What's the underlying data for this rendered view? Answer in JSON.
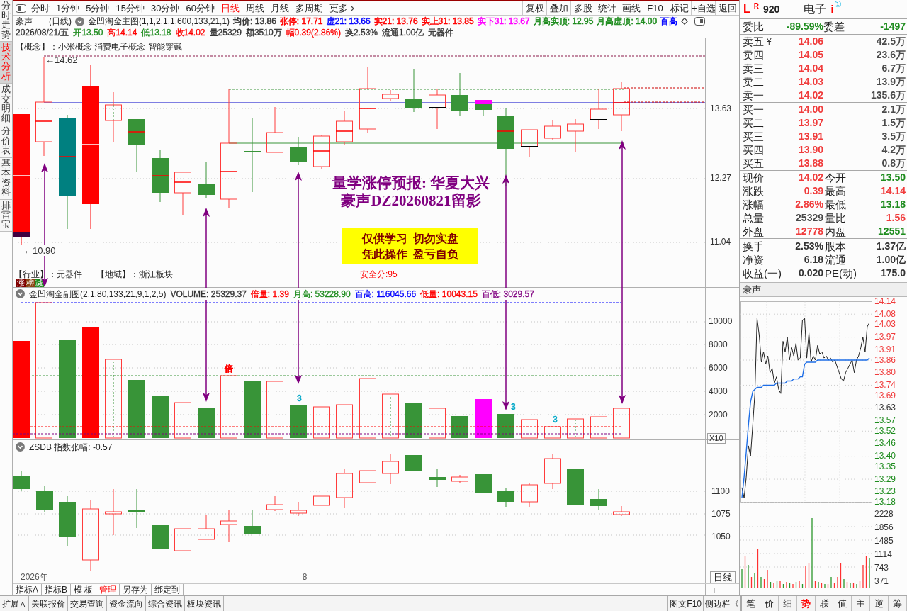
{
  "side_tabs": [
    {
      "label": "分时走势",
      "selected": false
    },
    {
      "label": "技术分析",
      "selected": true
    },
    {
      "label": "成交明细",
      "selected": false
    },
    {
      "label": "分价表",
      "selected": false
    },
    {
      "label": "基本资料",
      "selected": false
    },
    {
      "label": "排雷宝",
      "selected": false
    }
  ],
  "toolbar": {
    "periods": [
      {
        "label": "分时",
        "selected": false
      },
      {
        "label": "1分钟",
        "selected": false
      },
      {
        "label": "5分钟",
        "selected": false
      },
      {
        "label": "15分钟",
        "selected": false
      },
      {
        "label": "30分钟",
        "selected": false
      },
      {
        "label": "60分钟",
        "selected": false
      },
      {
        "label": "日线",
        "selected": true
      },
      {
        "label": "周线",
        "selected": false
      },
      {
        "label": "月线",
        "selected": false
      },
      {
        "label": "多周期",
        "selected": false
      },
      {
        "label": "更多",
        "selected": false
      }
    ],
    "buttons": [
      "复权",
      "叠加",
      "多股",
      "统计",
      "画线",
      "F10",
      "标记",
      "+自选",
      "返回"
    ]
  },
  "header": {
    "stock": "豪声",
    "period": "(日线)",
    "indicator": "金凹淘金主图(1,1,2,1,1,600,133,21,1)",
    "values": [
      {
        "text": "均价: 13.86",
        "color": "#333333"
      },
      {
        "text": "张停: 17.71",
        "color": "#ff0000"
      },
      {
        "text": "虚21: 13.66",
        "color": "#0000ff"
      },
      {
        "text": "实21: 13.76",
        "color": "#ff0000"
      },
      {
        "text": "实上31: 13.85",
        "color": "#ff0000"
      },
      {
        "text": "实下31: 13.67",
        "color": "#ff00ff"
      },
      {
        "text": "月高实顶: 12.95",
        "color": "#1e8c1e"
      },
      {
        "text": "月高虚顶: 14.00",
        "color": "#1e8c1e"
      },
      {
        "text": "百高",
        "color": "#0000ff"
      }
    ],
    "quote": [
      {
        "text": "2026/08/21/五",
        "color": "#333333"
      },
      {
        "text": "开13.50",
        "color": "#1e8c1e"
      },
      {
        "text": "高14.14",
        "color": "#ff0000"
      },
      {
        "text": "低13.18",
        "color": "#1e8c1e"
      },
      {
        "text": "收14.02",
        "color": "#ff0000"
      },
      {
        "text": "量25329",
        "color": "#333333"
      },
      {
        "text": "额3510万",
        "color": "#333333"
      },
      {
        "text": "幅0.39(2.86%)",
        "color": "#ff0000"
      },
      {
        "text": "换2.53%",
        "color": "#333333"
      },
      {
        "text": "流通1.00亿",
        "color": "#333333"
      },
      {
        "text": "元器件",
        "color": "#333333"
      }
    ]
  },
  "main_chart": {
    "concepts": "【概念】：小米概念 消费电子概念 智能穿戴",
    "high_marker": "←14.62",
    "low_marker": "←10.90",
    "y_labels": [
      "13.63",
      "12.27",
      "11.04"
    ],
    "forecast_lines": [
      "量学涨停预报: 华夏大兴",
      "豪声DZ20260821留影"
    ],
    "disclaimer_lines": [
      "仅供学习  切勿实盘",
      "凭此操作  盈亏自负"
    ],
    "industry": "【行业】：元器件",
    "region": "【地域】：浙江板块",
    "safety_score": "安全分:95",
    "rank_tags": [
      {
        "label": "涨",
        "color": "#800000"
      },
      {
        "label": "榜",
        "color": "#8b4513"
      },
      {
        "label": "减",
        "color": "#1e8c1e"
      }
    ]
  },
  "volume_panel": {
    "title": "金凹淘金副图(2,1.80,133,21,9,1,2,5)",
    "values": [
      {
        "text": "VOLUME: 25329.37",
        "color": "#333333"
      },
      {
        "text": "倍量: 1.39",
        "color": "#ff0000"
      },
      {
        "text": "月高: 53228.90",
        "color": "#1e8c1e"
      },
      {
        "text": "百高: 116045.66",
        "color": "#0000ff"
      },
      {
        "text": "低量: 10043.15",
        "color": "#ff0000"
      },
      {
        "text": "百低: 3029.57",
        "color": "#800080"
      }
    ],
    "y_labels": [
      "10000",
      "8000",
      "6000",
      "4000",
      "2000"
    ],
    "scale_label": "X10",
    "bar_marks": [
      {
        "text": "倍",
        "color": "#ff0000"
      },
      {
        "text": "3",
        "color": "#00a8c8"
      },
      {
        "text": "3",
        "color": "#00a8c8"
      },
      {
        "text": "3",
        "color": "#00a8c8"
      }
    ]
  },
  "index_panel": {
    "title": "ZSDB 指数张幅: -0.57",
    "y_labels": [
      "1100",
      "1075",
      "1050"
    ]
  },
  "time_axis": {
    "labels": [
      "2026年",
      "8"
    ],
    "period": "日线",
    "zoom_buttons": [
      "+",
      "−"
    ]
  },
  "bottom_tabs": [
    {
      "label": "指标A",
      "selected": false
    },
    {
      "label": "指标B",
      "selected": false
    },
    {
      "label": "模 板",
      "selected": false
    },
    {
      "label": "管理",
      "selected": true
    },
    {
      "label": "另存为",
      "selected": false
    },
    {
      "label": "绑定到",
      "selected": false
    }
  ],
  "status_bar": {
    "links": [
      "扩展∧",
      "关联报价",
      "交易查询",
      "资金流向",
      "综合资讯",
      "板块资讯"
    ],
    "side_buttons": [
      "图文F10",
      "侧边栏《"
    ],
    "shortcuts": [
      {
        "label": "笔",
        "selected": false
      },
      {
        "label": "价",
        "selected": false
      },
      {
        "label": "细",
        "selected": false
      },
      {
        "label": "势",
        "selected": true
      },
      {
        "label": "联",
        "selected": false
      },
      {
        "label": "值",
        "selected": false
      },
      {
        "label": "主",
        "selected": false
      },
      {
        "label": "逆",
        "selected": false
      },
      {
        "label": "筹",
        "selected": false
      }
    ]
  },
  "quote_panel": {
    "market": "L",
    "board": "R",
    "code": "920",
    "name": "电子",
    "info_mark": "i",
    "badge": "①",
    "ratio": [
      {
        "label": "委比",
        "value": "-89.59%",
        "color": "#1e8c1e"
      },
      {
        "label": "委差",
        "value": "-1497",
        "color": "#1e8c1e"
      }
    ],
    "asks": [
      {
        "label": "卖五",
        "mark": "¥",
        "price": "14.06",
        "volume": "42.5万"
      },
      {
        "label": "卖四",
        "price": "14.05",
        "volume": "23.6万"
      },
      {
        "label": "卖三",
        "price": "14.04",
        "volume": "6.7万"
      },
      {
        "label": "卖二",
        "price": "14.03",
        "volume": "13.9万"
      },
      {
        "label": "卖一",
        "price": "14.02",
        "volume": "135.6万"
      }
    ],
    "bids": [
      {
        "label": "买一",
        "price": "14.00",
        "volume": "2.1万"
      },
      {
        "label": "买二",
        "price": "13.97",
        "volume": "1.5万"
      },
      {
        "label": "买三",
        "price": "13.91",
        "volume": "3.5万"
      },
      {
        "label": "买四",
        "price": "13.90",
        "volume": "4.2万"
      },
      {
        "label": "买五",
        "price": "13.88",
        "volume": "0.8万"
      }
    ],
    "stats": [
      {
        "label": "现价",
        "value": "14.02",
        "color": "#f03c3c"
      },
      {
        "label": "今开",
        "value": "13.50",
        "color": "#1e8c1e"
      },
      {
        "label": "涨跌",
        "value": "0.39",
        "color": "#f03c3c"
      },
      {
        "label": "最高",
        "value": "14.14",
        "color": "#f03c3c"
      },
      {
        "label": "涨幅",
        "value": "2.86%",
        "color": "#f03c3c"
      },
      {
        "label": "最低",
        "value": "13.18",
        "color": "#1e8c1e"
      },
      {
        "label": "总量",
        "value": "25329",
        "color": "#4a4a4a"
      },
      {
        "label": "量比",
        "value": "1.56",
        "color": "#f03c3c"
      },
      {
        "label": "外盘",
        "value": "12778",
        "color": "#f03c3c"
      },
      {
        "label": "内盘",
        "value": "12551",
        "color": "#1e8c1e"
      }
    ],
    "fundamentals": [
      {
        "label": "换手",
        "value": "2.53%"
      },
      {
        "label": "股本",
        "value": "1.37亿"
      },
      {
        "label": "净资",
        "value": "6.18"
      },
      {
        "label": "流通",
        "value": "1.00亿"
      },
      {
        "label": "收益(一)",
        "value": "0.020"
      },
      {
        "label": "PE(动)",
        "value": "175.0"
      }
    ],
    "intraday": {
      "title": "豪声",
      "tick_styles": [
        {
          "color": "#f03c3c"
        },
        {
          "color": "#f03c3c"
        },
        {
          "color": "#f03c3c"
        },
        {
          "color": "#f03c3c"
        },
        {
          "color": "#f03c3c"
        },
        {
          "color": "#f03c3c"
        },
        {
          "color": "#f03c3c"
        },
        {
          "color": "#f03c3c"
        },
        {
          "color": "#f03c3c"
        },
        {
          "color": "#333333"
        },
        {
          "color": "#1e8c1e"
        },
        {
          "color": "#1e8c1e"
        },
        {
          "color": "#1e8c1e"
        },
        {
          "color": "#1e8c1e"
        },
        {
          "color": "#1e8c1e"
        },
        {
          "color": "#1e8c1e"
        },
        {
          "color": "#1e8c1e"
        },
        {
          "color": "#1e8c1e"
        }
      ],
      "chart_data": {
        "type": "line",
        "ylim": [
          13.18,
          14.14
        ],
        "yticks": [
          {
            "value": 14.14,
            "label": "14.14"
          },
          {
            "value": 14.08,
            "label": "14.08"
          },
          {
            "value": 14.03,
            "label": "14.03"
          },
          {
            "value": 13.97,
            "label": "13.97"
          },
          {
            "value": 13.91,
            "label": "13.91"
          },
          {
            "value": 13.86,
            "label": "13.86"
          },
          {
            "value": 13.8,
            "label": "13.80"
          },
          {
            "value": 13.74,
            "label": "13.74"
          },
          {
            "value": 13.69,
            "label": "13.69"
          },
          {
            "value": 13.63,
            "label": "13.63"
          },
          {
            "value": 13.57,
            "label": "13.57"
          },
          {
            "value": 13.52,
            "label": "13.52"
          },
          {
            "value": 13.46,
            "label": "13.46"
          },
          {
            "value": 13.4,
            "label": "13.40"
          },
          {
            "value": 13.35,
            "label": "13.35"
          },
          {
            "value": 13.29,
            "label": "13.29"
          },
          {
            "value": 13.23,
            "label": "13.23"
          },
          {
            "value": 13.18,
            "label": "13.18"
          }
        ],
        "grid": true,
        "series": [
          {
            "color": "#222222",
            "values": [
              13.25,
              13.2,
              13.3,
              13.45,
              13.4,
              13.55,
              13.7,
              14.06,
              13.98,
              13.85,
              13.9,
              13.84,
              13.88,
              13.8,
              13.82,
              13.75,
              13.78,
              13.72,
              13.7,
              13.95,
              13.9,
              13.97,
              13.86,
              13.92,
              13.88,
              13.94,
              13.86,
              13.87,
              14.05,
              14.06,
              13.87,
              13.99,
              13.85,
              13.88,
              13.86,
              13.93,
              13.89,
              13.9,
              13.87,
              13.88,
              13.86,
              13.87,
              13.85,
              13.86,
              13.83,
              13.8,
              13.77,
              13.76,
              13.8,
              13.82,
              13.84,
              13.86,
              13.8,
              13.86,
              13.88,
              13.92,
              13.97,
              13.9,
              14.02,
              14.04
            ]
          },
          {
            "color": "#1e6ee6",
            "values": [
              13.2,
              13.3,
              13.42,
              13.55,
              13.66,
              13.71,
              13.72,
              13.73,
              13.73,
              13.73,
              13.74,
              13.74,
              13.74,
              13.74,
              13.74,
              13.74,
              13.75,
              13.75,
              13.75,
              13.75,
              13.75,
              13.76,
              13.76,
              13.76,
              13.77,
              13.77,
              13.77,
              13.78,
              13.78,
              13.84,
              13.85,
              13.85,
              13.85,
              13.85,
              13.85,
              13.86,
              13.86,
              13.86,
              13.86,
              13.86,
              13.86,
              13.86,
              13.86,
              13.86,
              13.86,
              13.86,
              13.86,
              13.86,
              13.86,
              13.86,
              13.86,
              13.86,
              13.86,
              13.86,
              13.86,
              13.86,
              13.86,
              13.86,
              13.86,
              13.87
            ]
          }
        ]
      },
      "volume_labels": [
        "2228",
        "1856",
        "1485",
        "1114",
        "743",
        "371"
      ]
    }
  }
}
